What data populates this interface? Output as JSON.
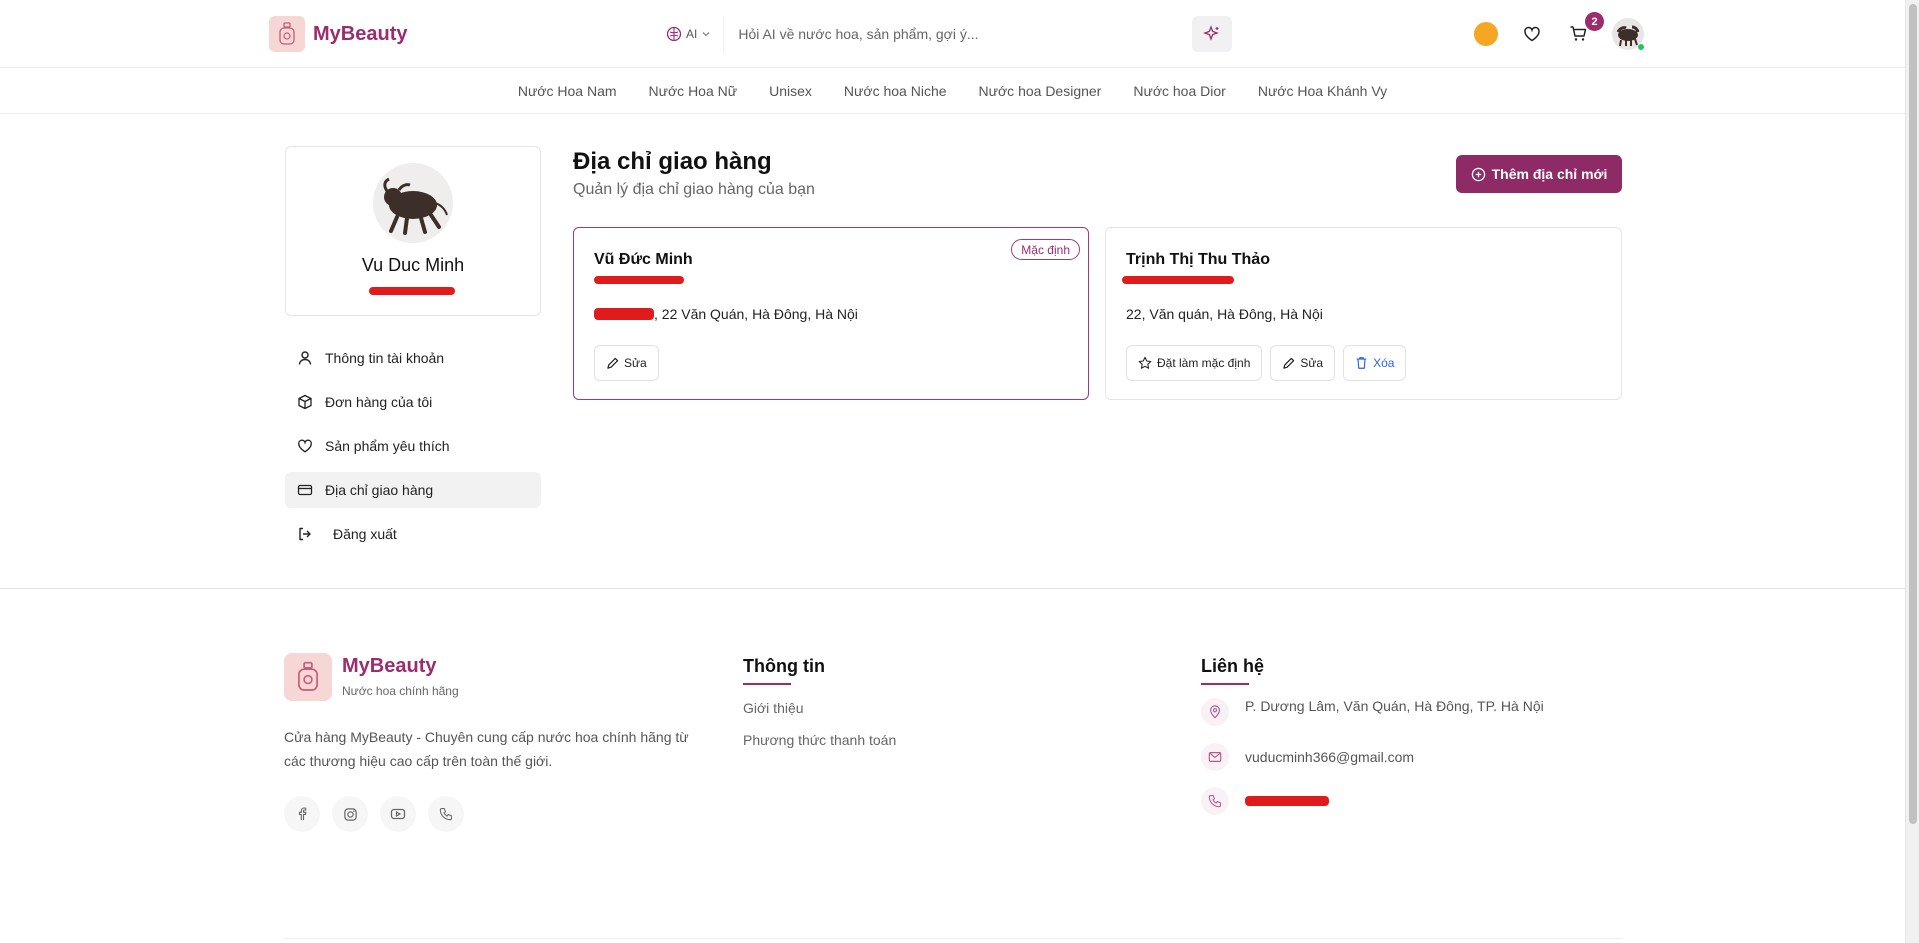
{
  "header": {
    "brand": "MyBeauty",
    "ai_label": "AI",
    "search_placeholder": "Hỏi AI về nước hoa, sản phẩm, gợi ý...",
    "cart_count": "2"
  },
  "categories": [
    "Nước Hoa Nam",
    "Nước Hoa Nữ",
    "Unisex",
    "Nước hoa Niche",
    "Nước hoa Designer",
    "Nước hoa Dior",
    "Nước Hoa Khánh Vy"
  ],
  "profile": {
    "name": "Vu Duc Minh"
  },
  "menu": {
    "account": "Thông tin tài khoản",
    "orders": "Đơn hàng của tôi",
    "favorites": "Sản phẩm yêu thích",
    "addresses": "Địa chỉ giao hàng",
    "logout": "Đăng xuất"
  },
  "main": {
    "title": "Địa chỉ giao hàng",
    "subtitle": "Quản lý địa chỉ giao hàng của bạn",
    "add_button": "Thêm địa chỉ mới"
  },
  "addresses": [
    {
      "name": "Vũ Đức Minh",
      "line": ", 22 Văn Quán, Hà Đông, Hà Nội",
      "badge": "Mặc định",
      "edit": "Sửa"
    },
    {
      "name": "Trịnh Thị Thu Thảo",
      "line": "22, Văn quán, Hà Đông, Hà Nội",
      "set_default": "Đặt làm mặc định",
      "edit": "Sửa",
      "delete": "Xóa"
    }
  ],
  "footer": {
    "brand": "MyBeauty",
    "tagline": "Nước hoa chính hãng",
    "description": "Cửa hàng MyBeauty - Chuyên cung cấp nước hoa chính hãng từ các thương hiệu cao cấp trên toàn thế giới.",
    "info_title": "Thông tin",
    "info_links": [
      "Giới thiệu",
      "Phương thức thanh toán"
    ],
    "contact_title": "Liên hệ",
    "address": "P. Dương Lâm, Văn Quán, Hà Đông, TP. Hà Nội",
    "email": "vuducminh366@gmail.com"
  },
  "colors": {
    "accent": "#9b2d6f",
    "button": "#8e2a66",
    "redaction": "#e01b1b"
  }
}
